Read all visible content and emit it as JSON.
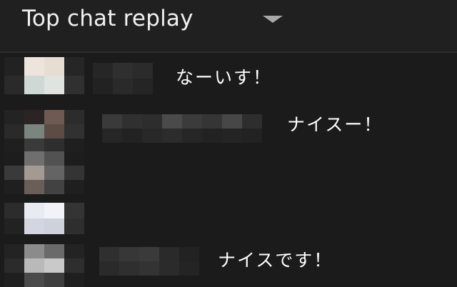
{
  "header": {
    "title": "Top chat replay",
    "menu_icon": "dropdown-caret-icon"
  },
  "messages": [
    {
      "text": "なーいす！"
    },
    {
      "text": "ナイスー！"
    },
    {
      "text": ""
    },
    {
      "text": ""
    },
    {
      "text": "ナイスです！"
    }
  ],
  "colors": {
    "background": "#1a1a1a",
    "header_background": "#202020",
    "text": "#ffffff",
    "title": "#f1f1f1"
  }
}
